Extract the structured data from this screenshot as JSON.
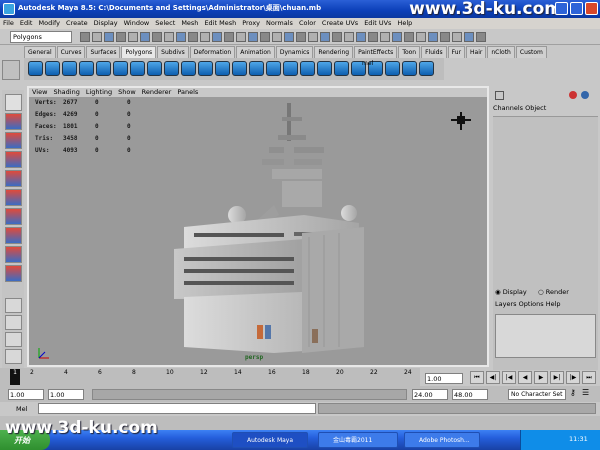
{
  "window": {
    "title": "Autodesk Maya 8.5: C:\\Documents and Settings\\Administrator\\桌面\\chuan.mb",
    "watermark": "www.3d-ku.com"
  },
  "menubar": [
    "File",
    "Edit",
    "Modify",
    "Create",
    "Display",
    "Window",
    "Select",
    "Mesh",
    "Edit Mesh",
    "Proxy",
    "Normals",
    "Color",
    "Create UVs",
    "Edit UVs",
    "Help"
  ],
  "statusline": {
    "module": "Polygons"
  },
  "shelf_tabs": [
    "General",
    "Curves",
    "Surfaces",
    "Polygons",
    "Subdivs",
    "Deformation",
    "Animation",
    "Dynamics",
    "Rendering",
    "PaintEffects",
    "Toon",
    "Fluids",
    "Fur",
    "Hair",
    "nCloth",
    "Custom"
  ],
  "active_shelf": "Polygons",
  "shelf_label": "mel",
  "panel_menu": [
    "View",
    "Shading",
    "Lighting",
    "Show",
    "Renderer",
    "Panels"
  ],
  "hud": [
    {
      "label": "Verts:",
      "v": "2677",
      "a": "0",
      "b": "0"
    },
    {
      "label": "Edges:",
      "v": "4269",
      "a": "0",
      "b": "0"
    },
    {
      "label": "Faces:",
      "v": "1801",
      "a": "0",
      "b": "0"
    },
    {
      "label": "Tris:",
      "v": "3458",
      "a": "0",
      "b": "0"
    },
    {
      "label": "UVs:",
      "v": "4093",
      "a": "0",
      "b": "0"
    }
  ],
  "camera_label": "persp",
  "channelbox": {
    "tabs": "Channels Object",
    "display_radio": "Display",
    "render_radio": "Render",
    "layers_menu": "Layers Options Help"
  },
  "timeline": {
    "ticks": [
      "2",
      "4",
      "6",
      "8",
      "10",
      "12",
      "14",
      "16",
      "18",
      "20",
      "22",
      "24"
    ],
    "current_frame": "1",
    "current_field": "1.00"
  },
  "range": {
    "start": "1.00",
    "start2": "1.00",
    "end": "24.00",
    "end2": "48.00",
    "character": "No Character Set"
  },
  "cmdline": {
    "label": "Mel"
  },
  "taskbar": {
    "start": "开始",
    "buttons": [
      "Autodesk Maya",
      "金山毒霸2011",
      "Adobe Photosh..."
    ],
    "clock": "11:31"
  }
}
